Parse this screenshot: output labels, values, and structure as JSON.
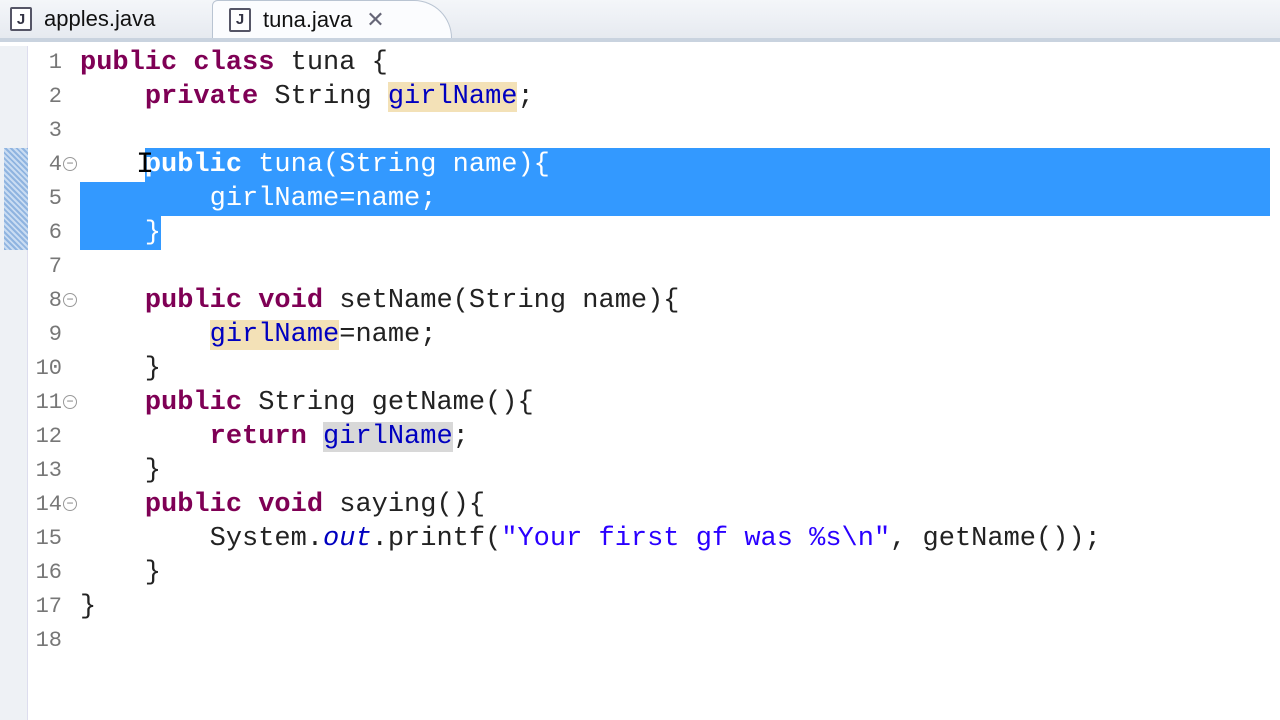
{
  "tabs": [
    {
      "label": "apples.java",
      "icon": "java-file-icon",
      "active": false
    },
    {
      "label": "tuna.java",
      "icon": "java-file-icon",
      "active": true,
      "close": "✕"
    }
  ],
  "colors": {
    "keyword": "#7f0055",
    "field": "#0000c0",
    "string": "#2a00ff",
    "selection": "#3399ff"
  },
  "lines": [
    {
      "n": "1",
      "fold": false,
      "tokens": [
        [
          "public",
          "kw"
        ],
        [
          " ",
          ""
        ],
        [
          "class",
          "kw"
        ],
        [
          " tuna {",
          ""
        ]
      ]
    },
    {
      "n": "2",
      "fold": false,
      "tokens": [
        [
          "    ",
          ""
        ],
        [
          "private",
          "kw"
        ],
        [
          " String ",
          ""
        ],
        [
          "girlName",
          "fld occ"
        ],
        [
          ";",
          ""
        ]
      ]
    },
    {
      "n": "3",
      "fold": false,
      "tokens": []
    },
    {
      "n": "4",
      "fold": true,
      "tokens": [
        [
          "    ",
          ""
        ],
        [
          "public",
          "kw"
        ],
        [
          " tuna(String name){",
          ""
        ]
      ]
    },
    {
      "n": "5",
      "fold": false,
      "tokens": [
        [
          "        ",
          ""
        ],
        [
          "girlName",
          "fld"
        ],
        [
          "=name;",
          ""
        ]
      ]
    },
    {
      "n": "6",
      "fold": false,
      "tokens": [
        [
          "    }",
          ""
        ]
      ]
    },
    {
      "n": "7",
      "fold": false,
      "tokens": []
    },
    {
      "n": "8",
      "fold": true,
      "tokens": [
        [
          "    ",
          ""
        ],
        [
          "public",
          "kw"
        ],
        [
          " ",
          ""
        ],
        [
          "void",
          "kw"
        ],
        [
          " setName(String name){",
          ""
        ]
      ]
    },
    {
      "n": "9",
      "fold": false,
      "tokens": [
        [
          "        ",
          ""
        ],
        [
          "girlName",
          "fld occ"
        ],
        [
          "=name;",
          ""
        ]
      ]
    },
    {
      "n": "10",
      "fold": false,
      "tokens": [
        [
          "    }",
          ""
        ]
      ]
    },
    {
      "n": "11",
      "fold": true,
      "tokens": [
        [
          "    ",
          ""
        ],
        [
          "public",
          "kw"
        ],
        [
          " String getName(){",
          ""
        ]
      ]
    },
    {
      "n": "12",
      "fold": false,
      "tokens": [
        [
          "        ",
          ""
        ],
        [
          "return",
          "kw"
        ],
        [
          " ",
          ""
        ],
        [
          "girlName",
          "fld occr"
        ],
        [
          ";",
          ""
        ]
      ]
    },
    {
      "n": "13",
      "fold": false,
      "tokens": [
        [
          "    }",
          ""
        ]
      ]
    },
    {
      "n": "14",
      "fold": true,
      "tokens": [
        [
          "    ",
          ""
        ],
        [
          "public",
          "kw"
        ],
        [
          " ",
          ""
        ],
        [
          "void",
          "kw"
        ],
        [
          " saying(){",
          ""
        ]
      ]
    },
    {
      "n": "15",
      "fold": false,
      "tokens": [
        [
          "        System.",
          ""
        ],
        [
          "out",
          "sfld"
        ],
        [
          ".printf(",
          ""
        ],
        [
          "\"Your first gf was %s\\n\"",
          "str"
        ],
        [
          ", getName());",
          ""
        ]
      ]
    },
    {
      "n": "16",
      "fold": false,
      "tokens": [
        [
          "    }",
          ""
        ]
      ]
    },
    {
      "n": "17",
      "fold": false,
      "tokens": [
        [
          "}",
          ""
        ]
      ]
    },
    {
      "n": "18",
      "fold": false,
      "tokens": []
    }
  ]
}
